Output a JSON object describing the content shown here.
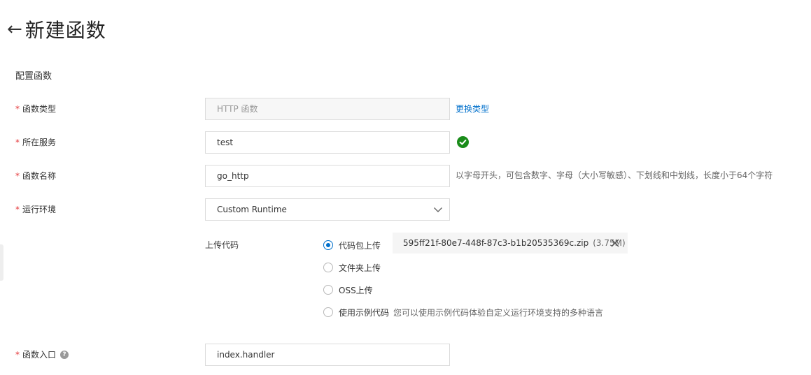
{
  "header": {
    "back_icon": "arrow-left-icon",
    "title": "新建函数"
  },
  "section_title": "配置函数",
  "form": {
    "function_type": {
      "label": "函数类型",
      "value": "HTTP 函数",
      "change_link": "更换类型"
    },
    "service": {
      "label": "所在服务",
      "value": "test",
      "status_icon": "check-circle-icon"
    },
    "function_name": {
      "label": "函数名称",
      "value": "go_http",
      "hint": "以字母开头，可包含数字、字母（大小写敏感）、下划线和中划线，长度小于64个字符"
    },
    "runtime": {
      "label": "运行环境",
      "value": "Custom Runtime"
    },
    "upload": {
      "label": "上传代码",
      "options": [
        {
          "label": "代码包上传",
          "checked": true,
          "desc": ""
        },
        {
          "label": "文件夹上传",
          "checked": false,
          "desc": ""
        },
        {
          "label": "OSS上传",
          "checked": false,
          "desc": ""
        },
        {
          "label": "使用示例代码",
          "checked": false,
          "desc": "您可以使用示例代码体验自定义运行环境支持的多种语言"
        }
      ],
      "file_name": "595ff21f-80e7-448f-87c3-b1b20535369c.zip",
      "file_size": "(3.75M)"
    },
    "entry": {
      "label": "函数入口",
      "value": "index.handler"
    }
  },
  "required_mark": "*",
  "colors": {
    "accent": "#0070cc",
    "success": "#1a8c1a",
    "required": "#e4393c"
  }
}
